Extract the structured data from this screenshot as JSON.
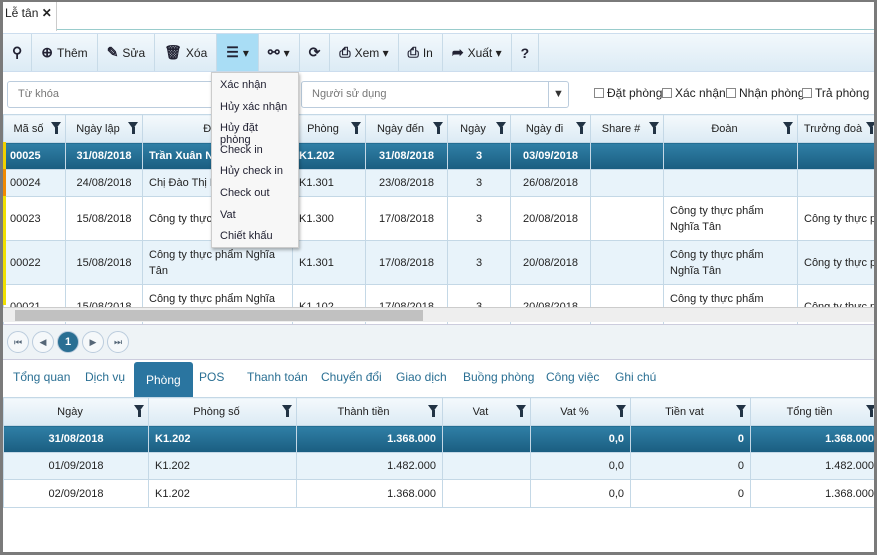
{
  "tab": {
    "label": "Lễ tân"
  },
  "toolbar": [
    {
      "icon": "binoculars-icon",
      "label": "",
      "g": "⚲"
    },
    {
      "icon": "plus-circle-icon",
      "label": "Thêm",
      "g": "⊕"
    },
    {
      "icon": "pencil-icon",
      "label": "Sửa",
      "g": "✎"
    },
    {
      "icon": "trash-icon",
      "label": "Xóa",
      "g": "🗑"
    },
    {
      "icon": "menu-icon",
      "label": "▾",
      "g": "☰"
    },
    {
      "icon": "link-icon",
      "label": "▾",
      "g": "⚯"
    },
    {
      "icon": "refresh-icon",
      "label": "",
      "g": "⟳"
    },
    {
      "icon": "print-icon",
      "label": "Xem ▾",
      "g": "⎙"
    },
    {
      "icon": "print-icon",
      "label": "In",
      "g": "⎙"
    },
    {
      "icon": "share-icon",
      "label": "Xuất ▾",
      "g": "➦"
    },
    {
      "icon": "help-icon",
      "label": "",
      "g": "?"
    }
  ],
  "filter": {
    "keyword_placeholder": "Từ khóa",
    "user_placeholder": "Người sử dụng",
    "checks": [
      "Đặt phòng",
      "Xác nhận",
      "Nhận phòng",
      "Trả phòng"
    ]
  },
  "menu": [
    "Xác nhận",
    "Hủy xác nhận",
    "Hủy đặt phòng",
    "Check in",
    "Hủy check in",
    "Check out",
    "Vat",
    "Chiết khấu"
  ],
  "grid": {
    "columns": [
      "Mã số",
      "Ngày lập",
      "Đối",
      "Phòng",
      "Ngày đến",
      "Ngày",
      "Ngày đi",
      "Share #",
      "Đoàn",
      "Trưởng đoà"
    ],
    "rows": [
      [
        "00025",
        "31/08/2018",
        "Trần Xuân Ng",
        "K1.202",
        "31/08/2018",
        "3",
        "03/09/2018",
        "",
        "",
        ""
      ],
      [
        "00024",
        "24/08/2018",
        "Chị Đào Thị P",
        "K1.301",
        "23/08/2018",
        "3",
        "26/08/2018",
        "",
        "",
        ""
      ],
      [
        "00023",
        "15/08/2018",
        "Công ty thực p",
        "K1.300",
        "17/08/2018",
        "3",
        "20/08/2018",
        "",
        "Công ty thực phẩm Nghĩa Tân",
        "Công ty thực phẩ Tân"
      ],
      [
        "00022",
        "15/08/2018",
        "Công ty thực phẩm Nghĩa Tân",
        "K1.301",
        "17/08/2018",
        "3",
        "20/08/2018",
        "",
        "Công ty thực phẩm Nghĩa Tân",
        "Công ty thực phẩ Tân"
      ],
      [
        "00021",
        "15/08/2018",
        "Công ty thực phẩm Nghĩa Tân",
        "K1.102",
        "17/08/2018",
        "3",
        "20/08/2018",
        "",
        "Công ty thực phẩm Nghĩa",
        "Công ty thực phẩ"
      ]
    ]
  },
  "row_marks": [
    "#f0d000",
    "#f08a00",
    "#f0e000",
    "#f0e000",
    "#f0e000"
  ],
  "pager": {
    "page": "1"
  },
  "detail_tabs": [
    "Tổng quan",
    "Dịch vụ",
    "Phòng",
    "POS",
    "Thanh toán",
    "Chuyển đổi",
    "Giao dịch",
    "Buồng phòng",
    "Công việc",
    "Ghi chú"
  ],
  "detail": {
    "columns": [
      "Ngày",
      "Phòng số",
      "Thành tiền",
      "Vat",
      "Vat %",
      "Tiền vat",
      "Tổng tiền"
    ],
    "rows": [
      [
        "31/08/2018",
        "K1.202",
        "1.368.000",
        "",
        "0,0",
        "0",
        "1.368.000"
      ],
      [
        "01/09/2018",
        "K1.202",
        "1.482.000",
        "",
        "0,0",
        "0",
        "1.482.000"
      ],
      [
        "02/09/2018",
        "K1.202",
        "1.368.000",
        "",
        "0,0",
        "0",
        "1.368.000"
      ]
    ]
  }
}
